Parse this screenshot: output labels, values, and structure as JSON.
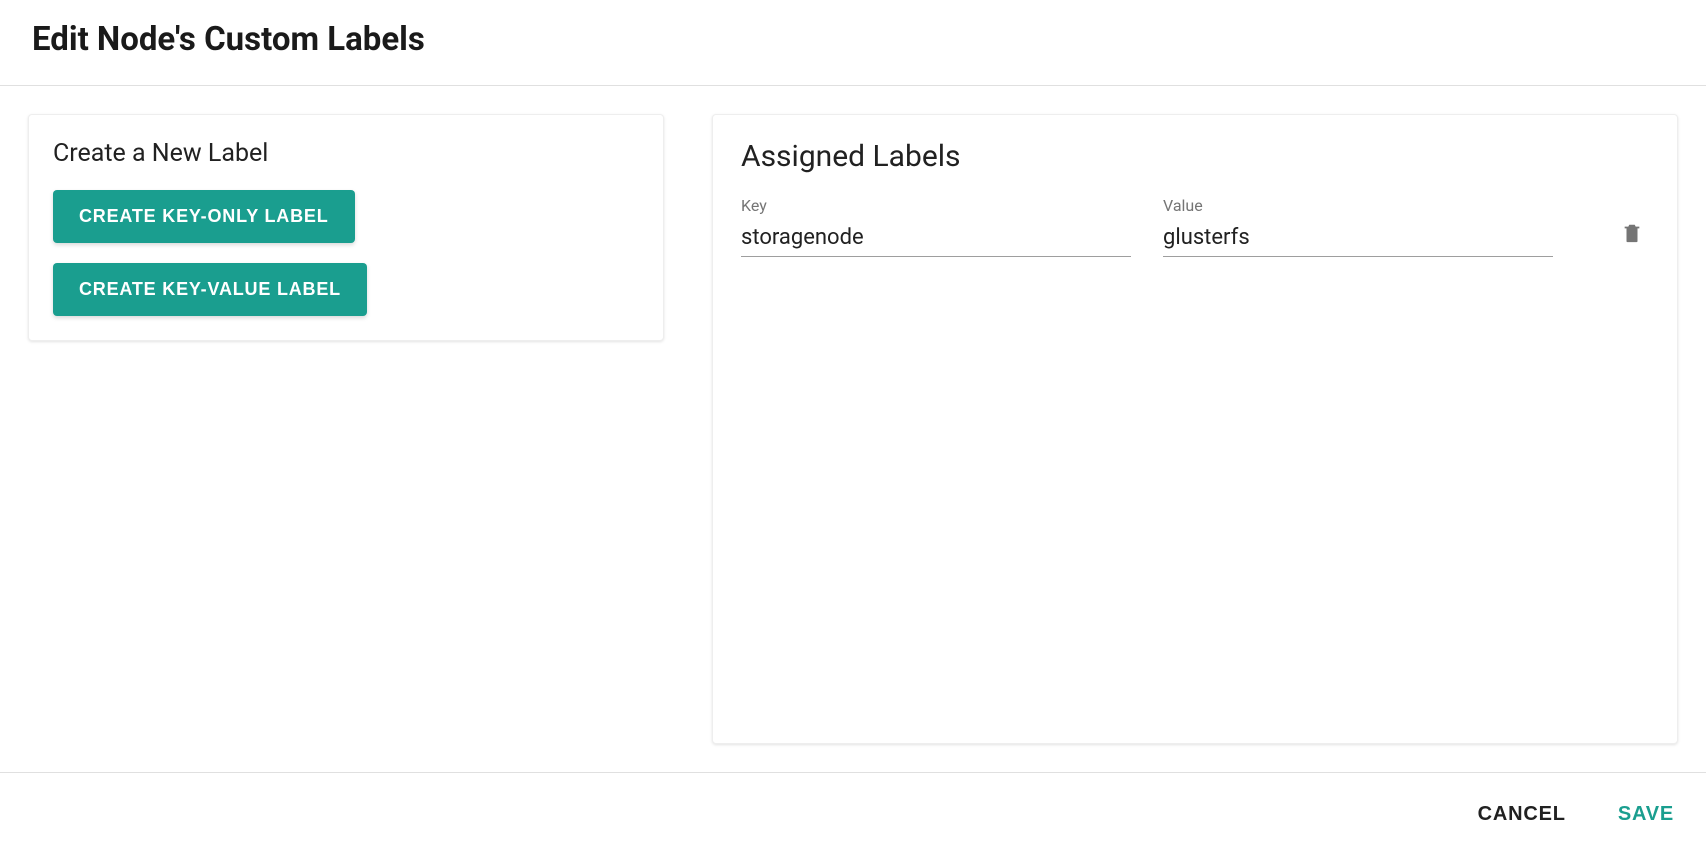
{
  "header": {
    "title": "Edit Node's Custom Labels"
  },
  "create_panel": {
    "title": "Create a New Label",
    "key_only_button": "CREATE KEY-ONLY LABEL",
    "key_value_button": "CREATE KEY-VALUE LABEL"
  },
  "assigned_panel": {
    "title": "Assigned Labels",
    "key_label": "Key",
    "value_label": "Value",
    "rows": [
      {
        "key": "storagenode",
        "value": "glusterfs"
      }
    ]
  },
  "footer": {
    "cancel": "CANCEL",
    "save": "SAVE"
  }
}
